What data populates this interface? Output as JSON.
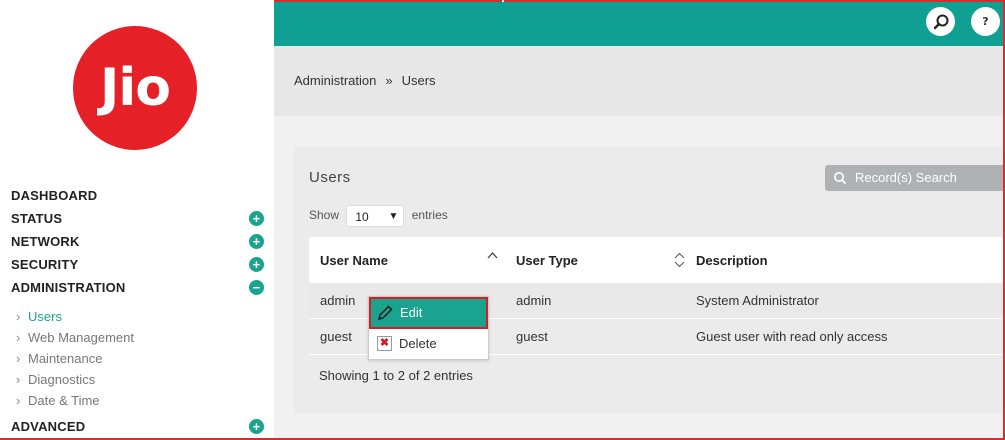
{
  "brand": {
    "logo_text": "Jio",
    "accent": "#0fa093",
    "logo_color": "#e52127"
  },
  "header": {
    "search_icon": "search-icon",
    "help_label": "?"
  },
  "nav": {
    "items": [
      {
        "label": "DASHBOARD",
        "toggle": ""
      },
      {
        "label": "STATUS",
        "toggle": "+"
      },
      {
        "label": "NETWORK",
        "toggle": "+"
      },
      {
        "label": "SECURITY",
        "toggle": "+"
      },
      {
        "label": "ADMINISTRATION",
        "toggle": "−"
      }
    ],
    "sub_items": [
      {
        "label": "Users",
        "active": true
      },
      {
        "label": "Web Management"
      },
      {
        "label": "Maintenance"
      },
      {
        "label": "Diagnostics"
      },
      {
        "label": "Date & Time"
      }
    ],
    "last_item": {
      "label": "ADVANCED",
      "toggle": "+"
    },
    "chevron": "›"
  },
  "breadcrumb": {
    "root": "Administration",
    "sep": "»",
    "current": "Users"
  },
  "panel": {
    "title": "Users",
    "search_placeholder": "Record(s) Search",
    "show_label": "Show",
    "entries_label": "entries",
    "page_size": "10",
    "columns": [
      "User Name",
      "User Type",
      "Description"
    ],
    "rows": [
      {
        "name": "admin",
        "type": "admin",
        "description": "System Administrator"
      },
      {
        "name": "guest",
        "type": "guest",
        "description": "Guest user with read only access"
      }
    ],
    "info": "Showing 1 to 2 of 2 entries"
  },
  "context_menu": {
    "edit_label": "Edit",
    "delete_label": "Delete"
  }
}
